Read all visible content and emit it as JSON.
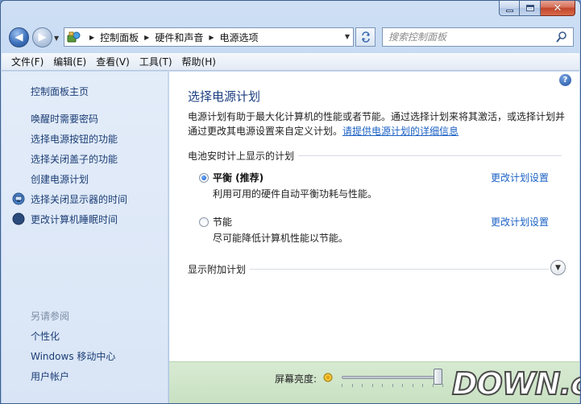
{
  "window": {
    "caption": {
      "minimize": "–",
      "maximize": "□",
      "close": "✕"
    }
  },
  "navigation": {
    "back_icon": "back-arrow-icon",
    "forward_icon": "forward-arrow-icon",
    "breadcrumbs": [
      "控制面板",
      "硬件和声音",
      "电源选项"
    ],
    "search_placeholder": "搜索控制面板"
  },
  "menu": [
    "文件(F)",
    "编辑(E)",
    "查看(V)",
    "工具(T)",
    "帮助(H)"
  ],
  "sidebar": {
    "home": "控制面板主页",
    "tasks": [
      {
        "label": "唤醒时需要密码",
        "icon": ""
      },
      {
        "label": "选择电源按钮的功能",
        "icon": ""
      },
      {
        "label": "选择关闭盖子的功能",
        "icon": ""
      },
      {
        "label": "创建电源计划",
        "icon": ""
      },
      {
        "label": "选择关闭显示器的时间",
        "icon": "display-icon"
      },
      {
        "label": "更改计算机睡眠时间",
        "icon": "moon-icon"
      }
    ],
    "see_also_title": "另请参阅",
    "see_also": [
      "个性化",
      "Windows 移动中心",
      "用户帐户"
    ]
  },
  "main": {
    "title": "选择电源计划",
    "intro": "电源计划有助于最大化计算机的性能或者节能。通过选择计划来将其激活，或选择计划并通过更改其电源设置来自定义计划。",
    "intro_link": "请提供电源计划的详细信息",
    "section_title": "电池安时计上显示的计划",
    "plans": [
      {
        "name": "平衡 (推荐)",
        "desc": "利用可用的硬件自动平衡功耗与性能。",
        "selected": true,
        "link": "更改计划设置"
      },
      {
        "name": "节能",
        "desc": "尽可能降低计算机性能以节能。",
        "selected": false,
        "link": "更改计划设置"
      }
    ],
    "more_plans": "显示附加计划"
  },
  "brightness": {
    "label": "屏幕亮度:",
    "level_percent": 95
  },
  "watermark": "DOWN.cc",
  "colors": {
    "link": "#1c62c5",
    "title": "#1a3d80",
    "sidebar_link": "#1c3e75"
  }
}
